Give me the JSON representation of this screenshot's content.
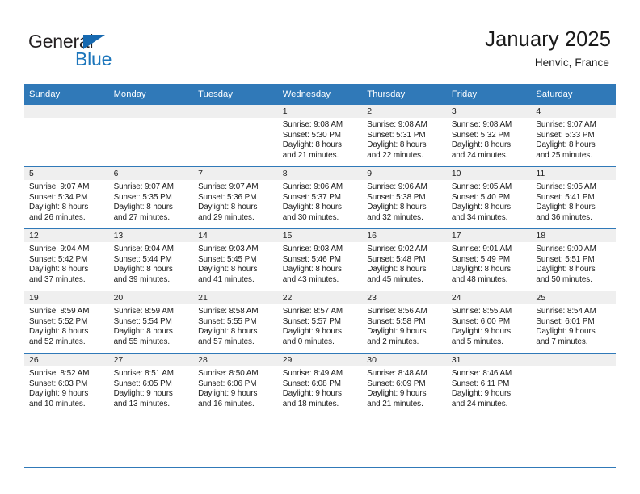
{
  "brand": {
    "name_part1": "General",
    "name_part2": "Blue",
    "triangle_color": "#1769b0",
    "blue_color": "#1b75bb"
  },
  "header": {
    "title": "January 2025",
    "subtitle": "Henvic, France"
  },
  "theme": {
    "header_blue": "#3079b8",
    "daynum_background": "#efefef",
    "text_color": "#1a1a1a"
  },
  "weekdays": [
    "Sunday",
    "Monday",
    "Tuesday",
    "Wednesday",
    "Thursday",
    "Friday",
    "Saturday"
  ],
  "weeks": [
    [
      {
        "day": "",
        "sunrise": "",
        "sunset": "",
        "daylight1": "",
        "daylight2": ""
      },
      {
        "day": "",
        "sunrise": "",
        "sunset": "",
        "daylight1": "",
        "daylight2": ""
      },
      {
        "day": "",
        "sunrise": "",
        "sunset": "",
        "daylight1": "",
        "daylight2": ""
      },
      {
        "day": "1",
        "sunrise": "Sunrise: 9:08 AM",
        "sunset": "Sunset: 5:30 PM",
        "daylight1": "Daylight: 8 hours",
        "daylight2": "and 21 minutes."
      },
      {
        "day": "2",
        "sunrise": "Sunrise: 9:08 AM",
        "sunset": "Sunset: 5:31 PM",
        "daylight1": "Daylight: 8 hours",
        "daylight2": "and 22 minutes."
      },
      {
        "day": "3",
        "sunrise": "Sunrise: 9:08 AM",
        "sunset": "Sunset: 5:32 PM",
        "daylight1": "Daylight: 8 hours",
        "daylight2": "and 24 minutes."
      },
      {
        "day": "4",
        "sunrise": "Sunrise: 9:07 AM",
        "sunset": "Sunset: 5:33 PM",
        "daylight1": "Daylight: 8 hours",
        "daylight2": "and 25 minutes."
      }
    ],
    [
      {
        "day": "5",
        "sunrise": "Sunrise: 9:07 AM",
        "sunset": "Sunset: 5:34 PM",
        "daylight1": "Daylight: 8 hours",
        "daylight2": "and 26 minutes."
      },
      {
        "day": "6",
        "sunrise": "Sunrise: 9:07 AM",
        "sunset": "Sunset: 5:35 PM",
        "daylight1": "Daylight: 8 hours",
        "daylight2": "and 27 minutes."
      },
      {
        "day": "7",
        "sunrise": "Sunrise: 9:07 AM",
        "sunset": "Sunset: 5:36 PM",
        "daylight1": "Daylight: 8 hours",
        "daylight2": "and 29 minutes."
      },
      {
        "day": "8",
        "sunrise": "Sunrise: 9:06 AM",
        "sunset": "Sunset: 5:37 PM",
        "daylight1": "Daylight: 8 hours",
        "daylight2": "and 30 minutes."
      },
      {
        "day": "9",
        "sunrise": "Sunrise: 9:06 AM",
        "sunset": "Sunset: 5:38 PM",
        "daylight1": "Daylight: 8 hours",
        "daylight2": "and 32 minutes."
      },
      {
        "day": "10",
        "sunrise": "Sunrise: 9:05 AM",
        "sunset": "Sunset: 5:40 PM",
        "daylight1": "Daylight: 8 hours",
        "daylight2": "and 34 minutes."
      },
      {
        "day": "11",
        "sunrise": "Sunrise: 9:05 AM",
        "sunset": "Sunset: 5:41 PM",
        "daylight1": "Daylight: 8 hours",
        "daylight2": "and 36 minutes."
      }
    ],
    [
      {
        "day": "12",
        "sunrise": "Sunrise: 9:04 AM",
        "sunset": "Sunset: 5:42 PM",
        "daylight1": "Daylight: 8 hours",
        "daylight2": "and 37 minutes."
      },
      {
        "day": "13",
        "sunrise": "Sunrise: 9:04 AM",
        "sunset": "Sunset: 5:44 PM",
        "daylight1": "Daylight: 8 hours",
        "daylight2": "and 39 minutes."
      },
      {
        "day": "14",
        "sunrise": "Sunrise: 9:03 AM",
        "sunset": "Sunset: 5:45 PM",
        "daylight1": "Daylight: 8 hours",
        "daylight2": "and 41 minutes."
      },
      {
        "day": "15",
        "sunrise": "Sunrise: 9:03 AM",
        "sunset": "Sunset: 5:46 PM",
        "daylight1": "Daylight: 8 hours",
        "daylight2": "and 43 minutes."
      },
      {
        "day": "16",
        "sunrise": "Sunrise: 9:02 AM",
        "sunset": "Sunset: 5:48 PM",
        "daylight1": "Daylight: 8 hours",
        "daylight2": "and 45 minutes."
      },
      {
        "day": "17",
        "sunrise": "Sunrise: 9:01 AM",
        "sunset": "Sunset: 5:49 PM",
        "daylight1": "Daylight: 8 hours",
        "daylight2": "and 48 minutes."
      },
      {
        "day": "18",
        "sunrise": "Sunrise: 9:00 AM",
        "sunset": "Sunset: 5:51 PM",
        "daylight1": "Daylight: 8 hours",
        "daylight2": "and 50 minutes."
      }
    ],
    [
      {
        "day": "19",
        "sunrise": "Sunrise: 8:59 AM",
        "sunset": "Sunset: 5:52 PM",
        "daylight1": "Daylight: 8 hours",
        "daylight2": "and 52 minutes."
      },
      {
        "day": "20",
        "sunrise": "Sunrise: 8:59 AM",
        "sunset": "Sunset: 5:54 PM",
        "daylight1": "Daylight: 8 hours",
        "daylight2": "and 55 minutes."
      },
      {
        "day": "21",
        "sunrise": "Sunrise: 8:58 AM",
        "sunset": "Sunset: 5:55 PM",
        "daylight1": "Daylight: 8 hours",
        "daylight2": "and 57 minutes."
      },
      {
        "day": "22",
        "sunrise": "Sunrise: 8:57 AM",
        "sunset": "Sunset: 5:57 PM",
        "daylight1": "Daylight: 9 hours",
        "daylight2": "and 0 minutes."
      },
      {
        "day": "23",
        "sunrise": "Sunrise: 8:56 AM",
        "sunset": "Sunset: 5:58 PM",
        "daylight1": "Daylight: 9 hours",
        "daylight2": "and 2 minutes."
      },
      {
        "day": "24",
        "sunrise": "Sunrise: 8:55 AM",
        "sunset": "Sunset: 6:00 PM",
        "daylight1": "Daylight: 9 hours",
        "daylight2": "and 5 minutes."
      },
      {
        "day": "25",
        "sunrise": "Sunrise: 8:54 AM",
        "sunset": "Sunset: 6:01 PM",
        "daylight1": "Daylight: 9 hours",
        "daylight2": "and 7 minutes."
      }
    ],
    [
      {
        "day": "26",
        "sunrise": "Sunrise: 8:52 AM",
        "sunset": "Sunset: 6:03 PM",
        "daylight1": "Daylight: 9 hours",
        "daylight2": "and 10 minutes."
      },
      {
        "day": "27",
        "sunrise": "Sunrise: 8:51 AM",
        "sunset": "Sunset: 6:05 PM",
        "daylight1": "Daylight: 9 hours",
        "daylight2": "and 13 minutes."
      },
      {
        "day": "28",
        "sunrise": "Sunrise: 8:50 AM",
        "sunset": "Sunset: 6:06 PM",
        "daylight1": "Daylight: 9 hours",
        "daylight2": "and 16 minutes."
      },
      {
        "day": "29",
        "sunrise": "Sunrise: 8:49 AM",
        "sunset": "Sunset: 6:08 PM",
        "daylight1": "Daylight: 9 hours",
        "daylight2": "and 18 minutes."
      },
      {
        "day": "30",
        "sunrise": "Sunrise: 8:48 AM",
        "sunset": "Sunset: 6:09 PM",
        "daylight1": "Daylight: 9 hours",
        "daylight2": "and 21 minutes."
      },
      {
        "day": "31",
        "sunrise": "Sunrise: 8:46 AM",
        "sunset": "Sunset: 6:11 PM",
        "daylight1": "Daylight: 9 hours",
        "daylight2": "and 24 minutes."
      },
      {
        "day": "",
        "sunrise": "",
        "sunset": "",
        "daylight1": "",
        "daylight2": ""
      }
    ]
  ]
}
